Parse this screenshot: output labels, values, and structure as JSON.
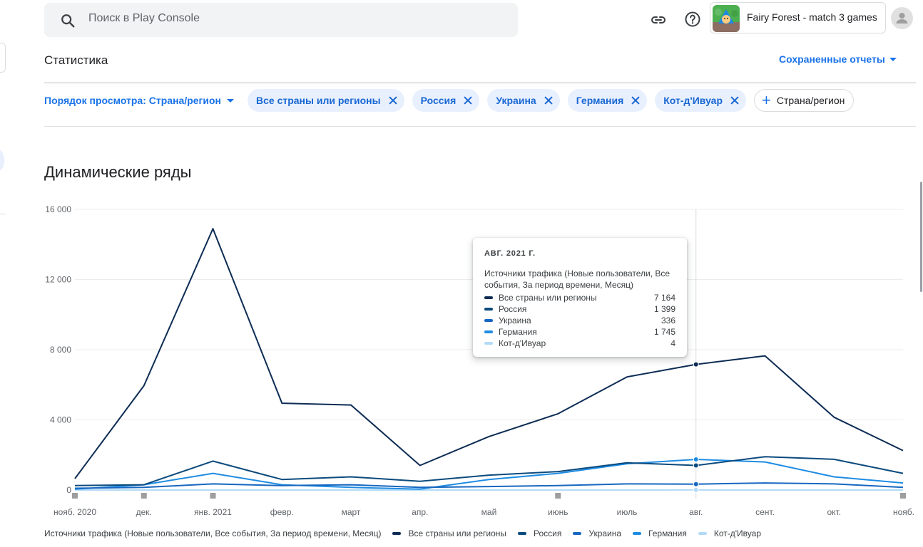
{
  "search": {
    "placeholder": "Поиск в Play Console"
  },
  "header": {
    "link_icon": "link-icon",
    "help_icon": "help-icon",
    "app_name": "Fairy Forest - match 3 games",
    "avatar_icon": "account-avatar"
  },
  "page": {
    "title": "Статистика",
    "saved_reports": "Сохраненные отчеты"
  },
  "filters": {
    "view_order": "Порядок просмотра: Страна/регион",
    "chips": [
      {
        "label": "Все страны или регионы"
      },
      {
        "label": "Россия"
      },
      {
        "label": "Украина"
      },
      {
        "label": "Германия"
      },
      {
        "label": "Кот-д'Ивуар"
      }
    ],
    "add_label": "Страна/регион"
  },
  "section": {
    "title": "Динамические ряды"
  },
  "chart_data": {
    "type": "line",
    "categories": [
      "нояб. 2020",
      "дек.",
      "янв. 2021",
      "февр.",
      "март",
      "апр.",
      "май",
      "июнь",
      "июль",
      "авг.",
      "сент.",
      "окт.",
      "нояб."
    ],
    "ylim": [
      0,
      16000
    ],
    "yticks": [
      "0",
      "4 000",
      "8 000",
      "12 000",
      "16 000"
    ],
    "ytick_values": [
      0,
      4000,
      8000,
      12000,
      16000
    ],
    "grid": true,
    "legend_position": "bottom",
    "legend_title": "Источники трафика (Новые пользователи, Все события, За период времени, Месяц)",
    "series": [
      {
        "name": "Все страны или регионы",
        "color": "#0d2c54",
        "values": [
          650,
          5950,
          14900,
          4950,
          4850,
          1400,
          3050,
          4350,
          6450,
          7164,
          7650,
          4150,
          2250
        ]
      },
      {
        "name": "Россия",
        "color": "#0b4a7d",
        "values": [
          250,
          300,
          1650,
          600,
          750,
          500,
          850,
          1050,
          1550,
          1399,
          1900,
          1750,
          950
        ]
      },
      {
        "name": "Украина",
        "color": "#1767c0",
        "values": [
          100,
          150,
          350,
          250,
          300,
          150,
          200,
          250,
          350,
          336,
          400,
          350,
          150
        ]
      },
      {
        "name": "Германия",
        "color": "#1e8ce3",
        "values": [
          50,
          300,
          950,
          300,
          150,
          50,
          600,
          950,
          1500,
          1745,
          1600,
          750,
          400
        ]
      },
      {
        "name": "Кот-д'Ивуар",
        "color": "#b3dbf7",
        "values": [
          0,
          0,
          0,
          0,
          0,
          0,
          0,
          0,
          0,
          4,
          0,
          0,
          0
        ]
      }
    ],
    "tooltip": {
      "date": "авг. 2021 г.",
      "description": "Источники трафика (Новые пользователи, Все события, За период времени, Месяц)",
      "rows": [
        {
          "name": "Все страны или регионы",
          "value": "7 164"
        },
        {
          "name": "Россия",
          "value": "1 399"
        },
        {
          "name": "Украина",
          "value": "336"
        },
        {
          "name": "Германия",
          "value": "1 745"
        },
        {
          "name": "Кот-д'Ивуар",
          "value": "4"
        }
      ]
    }
  }
}
